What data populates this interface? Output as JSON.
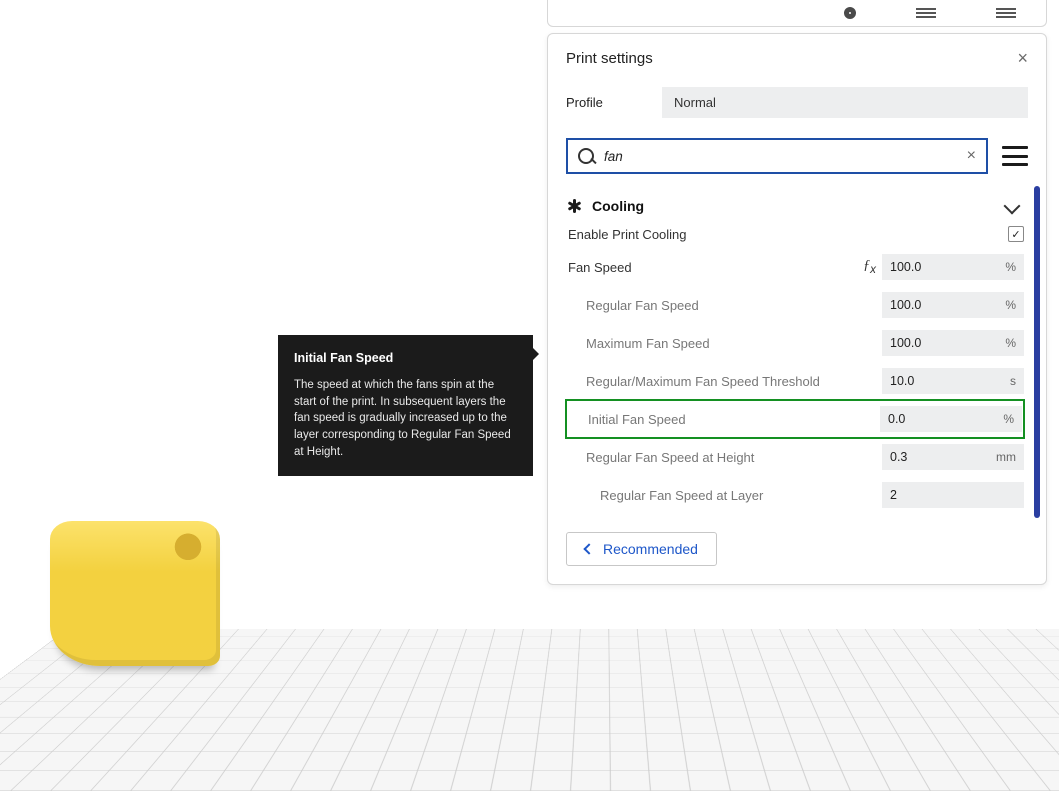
{
  "panel": {
    "title": "Print settings",
    "profile_label": "Profile",
    "profile_value": "Normal",
    "search_value": "fan",
    "recommended_label": "Recommended"
  },
  "section": {
    "title": "Cooling"
  },
  "settings": {
    "enable_label": "Enable Print Cooling",
    "fanspeed_label": "Fan Speed",
    "fanspeed_value": "100.0",
    "pct": "%",
    "sec": "s",
    "mm": "mm",
    "reg_label": "Regular Fan Speed",
    "reg_value": "100.0",
    "max_label": "Maximum Fan Speed",
    "max_value": "100.0",
    "thresh_label": "Regular/Maximum Fan Speed Threshold",
    "thresh_value": "10.0",
    "init_label": "Initial Fan Speed",
    "init_value": "0.0",
    "height_label": "Regular Fan Speed at Height",
    "height_value": "0.3",
    "layer_label": "Regular Fan Speed at Layer",
    "layer_value": "2"
  },
  "tooltip": {
    "title": "Initial Fan Speed",
    "body": "The speed at which the fans spin at the start of the print. In subsequent layers the fan speed is gradually increased up to the layer corresponding to Regular Fan Speed at Height."
  }
}
